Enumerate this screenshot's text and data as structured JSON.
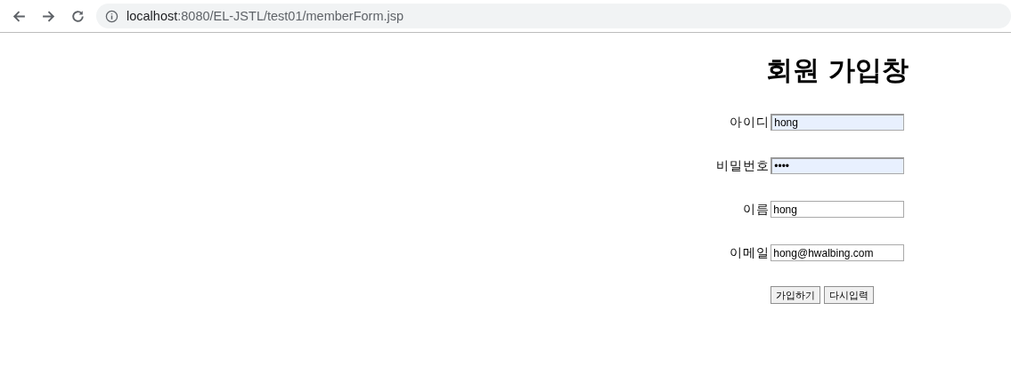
{
  "browser": {
    "url_host": "localhost",
    "url_rest": ":8080/EL-JSTL/test01/memberForm.jsp"
  },
  "title": "회원 가입창",
  "fields": [
    {
      "label": "아이디",
      "value": "hong",
      "autofilled": true
    },
    {
      "label": "비밀번호",
      "value": "••••",
      "autofilled": true
    },
    {
      "label": "이름",
      "value": "hong",
      "autofilled": false
    },
    {
      "label": "이메일",
      "value": "hong@hwalbing.com",
      "autofilled": false
    }
  ],
  "buttons": [
    "가입하기",
    "다시입력"
  ]
}
